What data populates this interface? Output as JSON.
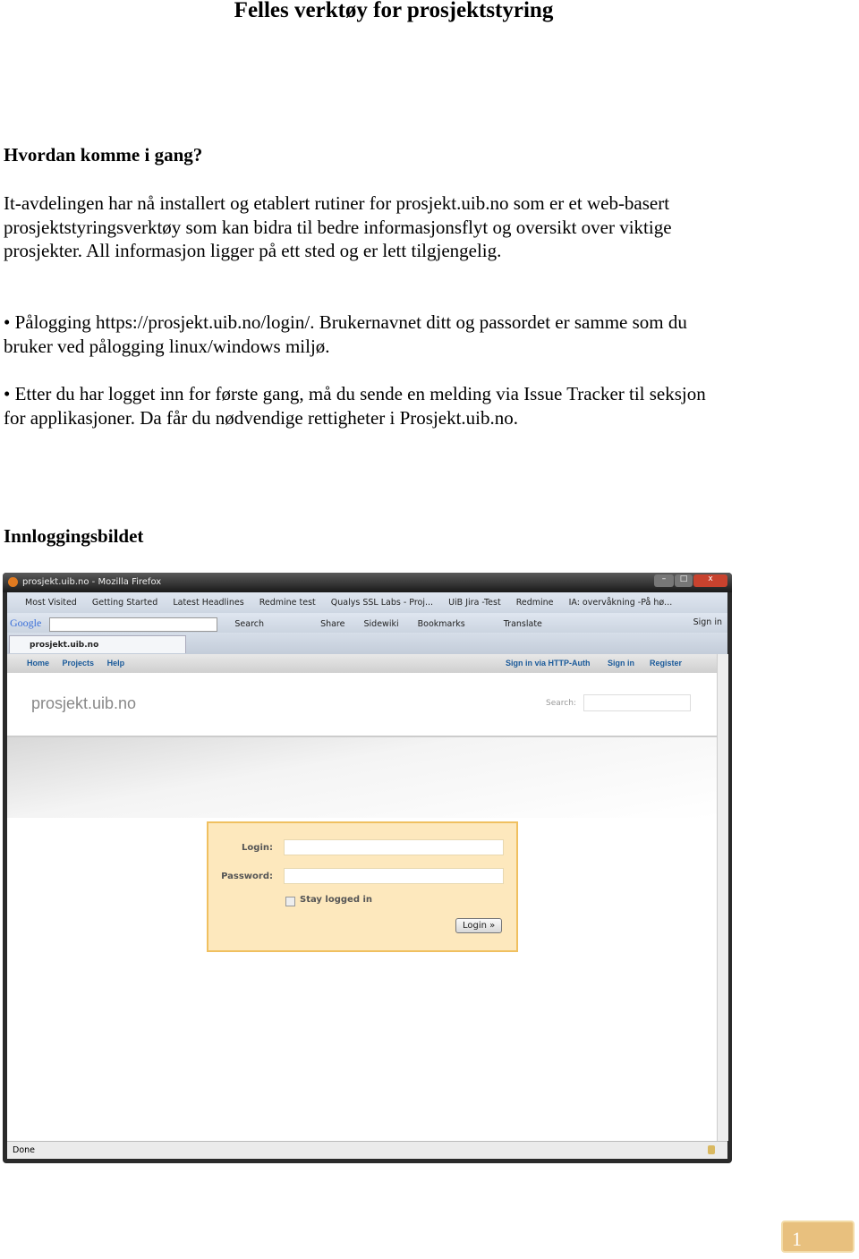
{
  "title": "Felles verktøy for prosjektstyring",
  "section1": {
    "heading": "Hvordan komme i gang?",
    "lines": [
      "It-avdelingen har nå installert og etablert rutiner for prosjekt.uib.no som er et web-basert",
      "prosjektstyringsverktøy som kan bidra til bedre informasjonsflyt og oversikt over viktige",
      "prosjekter. All informasjon ligger på ett sted og er lett tilgjengelig."
    ],
    "bullet1": [
      "• Pålogging https://prosjekt.uib.no/login/. Brukernavnet ditt og passordet er samme som du",
      "bruker ved pålogging linux/windows miljø."
    ],
    "bullet2": [
      "• Etter du har logget inn for første gang, må du sende en melding  via Issue Tracker til seksjon",
      "for applikasjoner. Da får du nødvendige rettigheter i Prosjekt.uib.no."
    ]
  },
  "section2": {
    "heading": "Innloggingsbildet"
  },
  "browser": {
    "window_title": "prosjekt.uib.no - Mozilla Firefox",
    "bookmarks": [
      "Most Visited",
      "Getting Started",
      "Latest Headlines",
      "Redmine test",
      "Qualys SSL Labs - Proj...",
      "UiB Jira -Test",
      "Redmine",
      "IA: overvåkning -På hø..."
    ],
    "google_toolbar": {
      "logo": "Google",
      "items": [
        "Search",
        "Share",
        "Sidewiki",
        "Bookmarks",
        "Translate"
      ],
      "sign_in": "Sign in"
    },
    "tab": "prosjekt.uib.no",
    "nav_left": [
      "Home",
      "Projects",
      "Help"
    ],
    "nav_right": [
      "Sign in via HTTP-Auth",
      "Sign in",
      "Register"
    ],
    "site_title": "prosjekt.uib.no",
    "search_label": "Search:",
    "login_label": "Login:",
    "password_label": "Password:",
    "stay_logged_in": "Stay logged in",
    "login_button": "Login »",
    "status": "Done"
  },
  "page_number": "1",
  "colors": {
    "login_box": "#fde8bd",
    "login_border": "#f0c060",
    "nav_link": "#1a5a9a",
    "page_badge": "#e8c07e"
  }
}
